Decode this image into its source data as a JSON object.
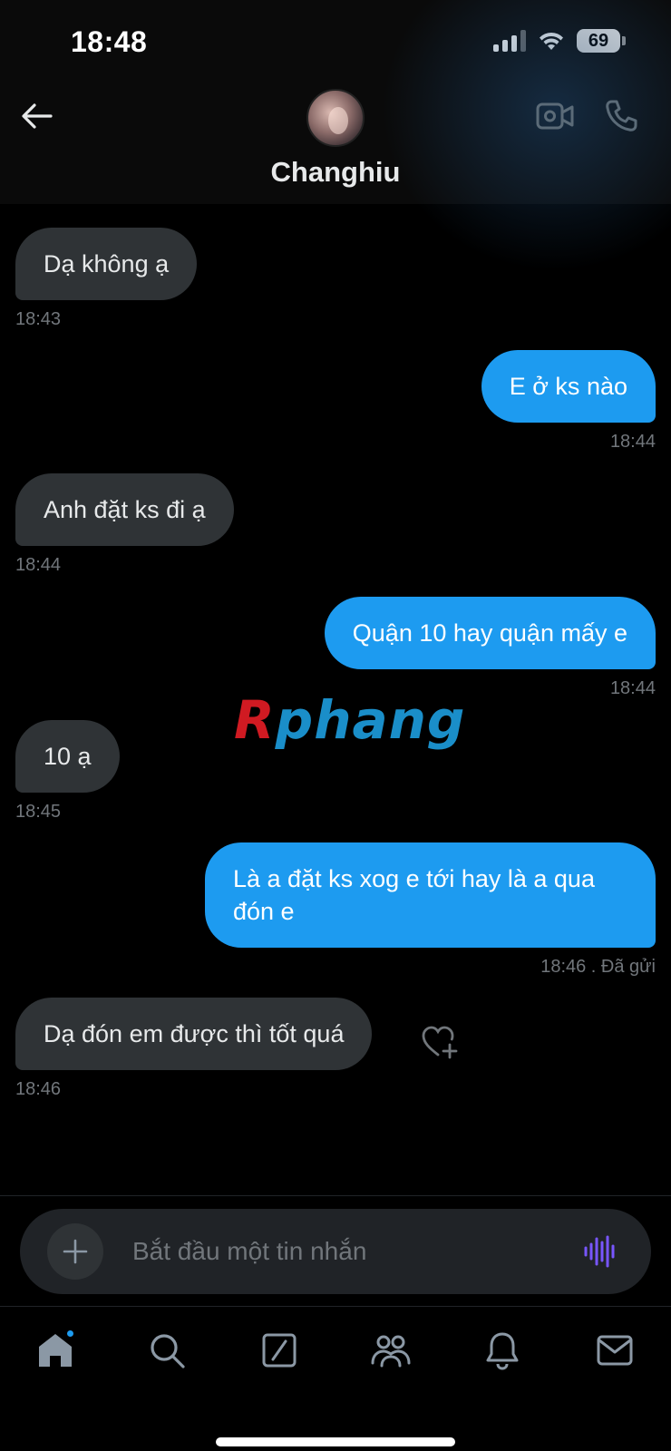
{
  "status_bar": {
    "time": "18:48",
    "battery": "69"
  },
  "header": {
    "contact_name": "Changhiu",
    "icons": [
      "arrow-left-icon",
      "video-camera-icon",
      "phone-icon"
    ]
  },
  "messages": [
    {
      "direction": "in",
      "text": "Dạ không ạ",
      "time": "18:43"
    },
    {
      "direction": "out",
      "text": "E ở ks nào",
      "time": "18:44"
    },
    {
      "direction": "in",
      "text": "Anh đặt ks đi ạ",
      "time": "18:44"
    },
    {
      "direction": "out",
      "text": "Quận 10 hay quận mấy e",
      "time": "18:44"
    },
    {
      "direction": "in",
      "text": "10 ạ",
      "time": "18:45"
    },
    {
      "direction": "out",
      "text": "Là a đặt ks xog e tới hay là a qua đón e",
      "time": "18:46 . Đã gửi"
    },
    {
      "direction": "in",
      "text": "Dạ đón em được thì tốt quá",
      "time": "18:46"
    }
  ],
  "watermark": {
    "part1": "R",
    "part2": "phang"
  },
  "composer": {
    "placeholder": "Bắt đầu một tin nhắn",
    "value": ""
  },
  "colors": {
    "accent": "#1d9bf0",
    "incoming_bubble": "#2f3336",
    "voice_icon": "#7856ff",
    "background": "#000000"
  },
  "tabbar": {
    "items": [
      "home-icon",
      "search-icon",
      "grok-icon",
      "communities-icon",
      "notifications-icon",
      "messages-icon"
    ],
    "home_has_badge": true
  }
}
